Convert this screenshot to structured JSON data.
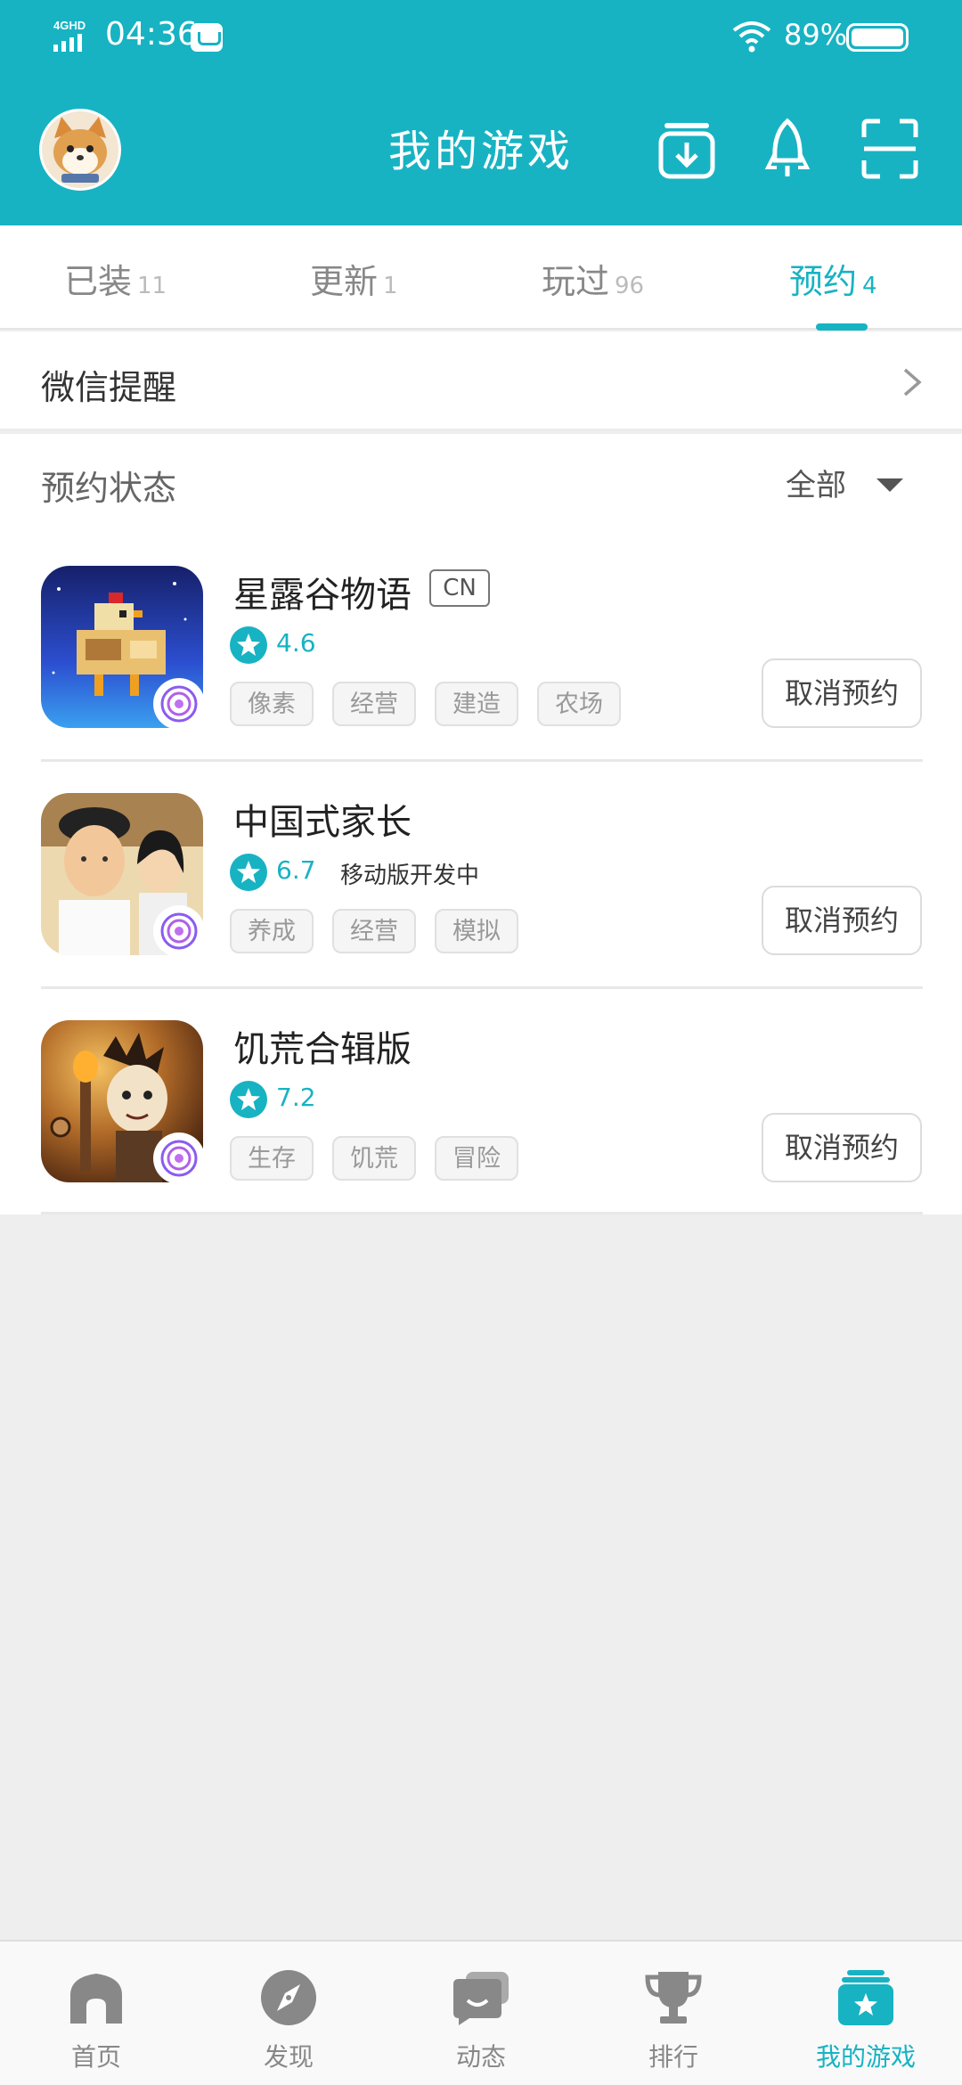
{
  "status_bar": {
    "network": "4GHD",
    "time": "04:36",
    "battery": "89%"
  },
  "header": {
    "title": "我的游戏",
    "icons": [
      "download-icon",
      "rocket-icon",
      "scan-icon"
    ]
  },
  "tabs": [
    {
      "label": "已装",
      "count": "11"
    },
    {
      "label": "更新",
      "count": "1"
    },
    {
      "label": "玩过",
      "count": "96"
    },
    {
      "label": "预约",
      "count": "4",
      "active": true
    }
  ],
  "wechat_reminder": {
    "label": "微信提醒"
  },
  "filter": {
    "label": "预约状态",
    "value": "全部"
  },
  "games": [
    {
      "title": "星露谷物语",
      "region_badge": "CN",
      "rating": "4.6",
      "note": "",
      "tags": [
        "像素",
        "经营",
        "建造",
        "农场"
      ],
      "action": "取消预约"
    },
    {
      "title": "中国式家长",
      "region_badge": "",
      "rating": "6.7",
      "note": "移动版开发中",
      "tags": [
        "养成",
        "经营",
        "模拟"
      ],
      "action": "取消预约"
    },
    {
      "title": "饥荒合辑版",
      "region_badge": "",
      "rating": "7.2",
      "note": "",
      "tags": [
        "生存",
        "饥荒",
        "冒险"
      ],
      "action": "取消预约"
    }
  ],
  "bottom_nav": [
    {
      "label": "首页",
      "icon": "home-icon"
    },
    {
      "label": "发现",
      "icon": "compass-icon"
    },
    {
      "label": "动态",
      "icon": "chat-icon"
    },
    {
      "label": "排行",
      "icon": "trophy-icon"
    },
    {
      "label": "我的游戏",
      "icon": "my-games-icon",
      "active": true
    }
  ],
  "colors": {
    "accent": "#17b3c3",
    "background": "#eeeeee",
    "tag_text": "#999999"
  }
}
